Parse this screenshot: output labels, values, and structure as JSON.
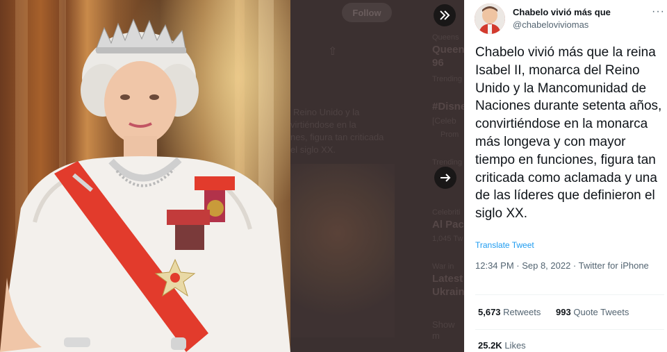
{
  "timeline_bg": {
    "follow_label": "Follow",
    "snippets": [
      "Queens",
      "Queen'",
      "96",
      "Trending",
      "#Disne",
      "[Celeb",
      "Prom",
      "Trending",
      "Reino Unido y la",
      "virtiéndose en la",
      "nes, figura tan criticada",
      "el siglo XX.",
      "Celebriti",
      "Al Pac",
      "1,045 Tw",
      "War in",
      "Latest",
      "Ukrain",
      "Show m"
    ]
  },
  "tweet": {
    "author_name": "Chabelo vivió más que",
    "author_handle": "@chabeloviviomas",
    "text": "Chabelo vivió más que la reina Isabel II, monarca del Reino Unido y la Mancomunidad de Naciones durante setenta años, convirtiéndose en la monarca más longeva y con mayor tiempo en funciones, figura tan criticada como aclamada y una de las líderes que definieron el siglo XX.",
    "translate_label": "Translate Tweet",
    "meta_time": "12:34 PM · Sep 8, 2022 · Twitter for iPhone",
    "retweets_count": "5,673",
    "retweets_label": "Retweets",
    "quotes_count": "993",
    "quotes_label": "Quote Tweets",
    "likes_count": "25.2K",
    "likes_label": "Likes"
  },
  "icons": {
    "collapse": "double-chevron-right-icon",
    "next": "arrow-right-icon",
    "more": "more-dots-icon",
    "share": "share-icon"
  },
  "colors": {
    "accent": "#1d9bf0",
    "sash": "#e23b2c"
  }
}
